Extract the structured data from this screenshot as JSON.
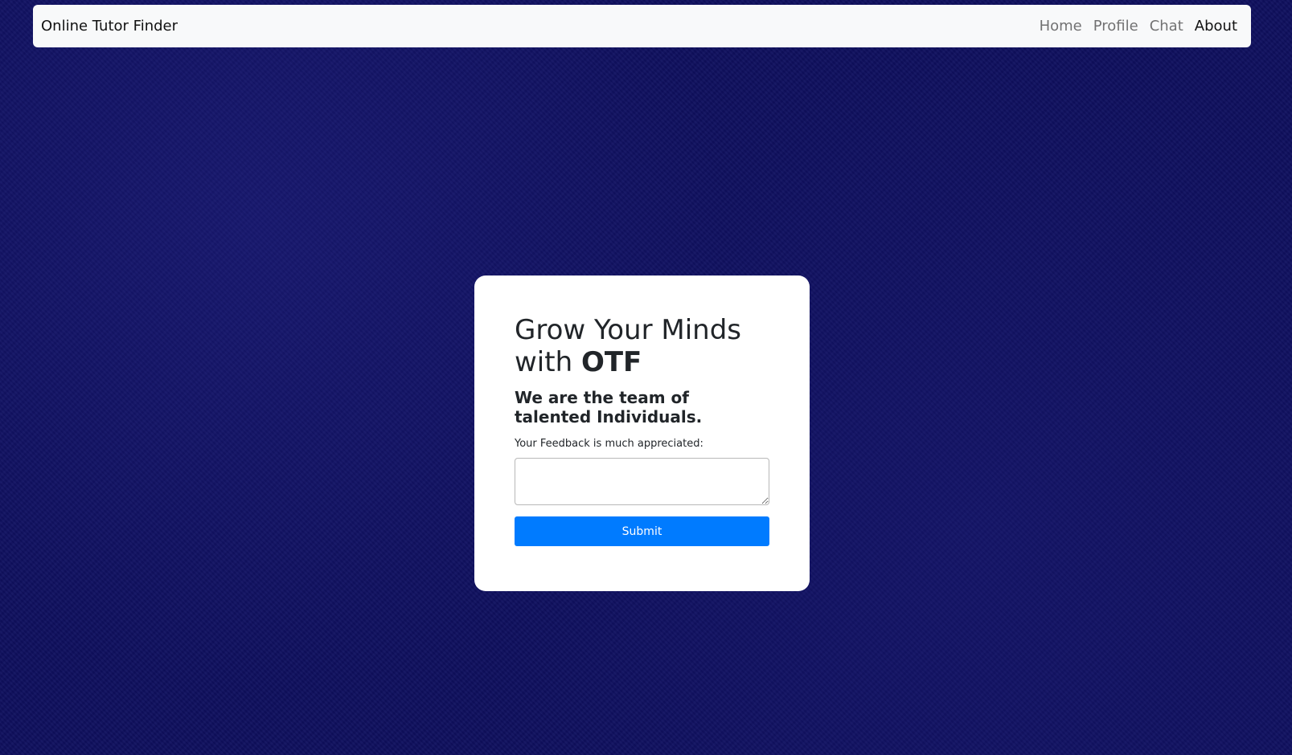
{
  "navbar": {
    "brand": "Online Tutor Finder",
    "links": [
      {
        "label": "Home",
        "active": false
      },
      {
        "label": "Profile",
        "active": false
      },
      {
        "label": "Chat",
        "active": false
      },
      {
        "label": "About",
        "active": true
      }
    ]
  },
  "card": {
    "headline_part1": "Grow Your Minds with ",
    "headline_bold": "OTF",
    "subheadline": "We are the team of talented Individuals.",
    "feedback_label": "Your Feedback is much appreciated:",
    "feedback_value": "",
    "submit_label": "Submit"
  },
  "colors": {
    "background": "#0e0f5e",
    "navbar_bg": "#f8f9fa",
    "button": "#007bff"
  }
}
